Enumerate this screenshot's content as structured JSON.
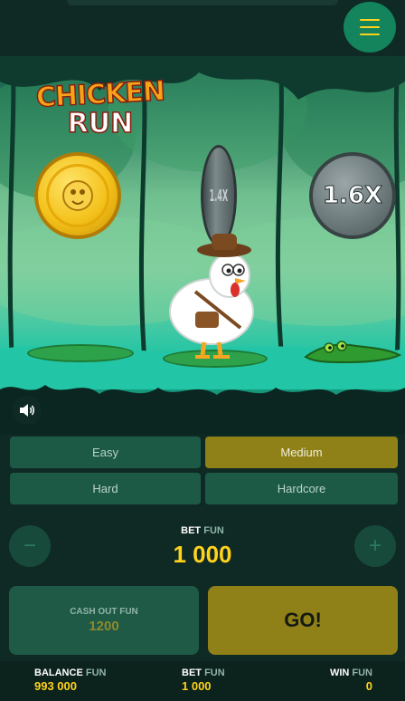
{
  "game": {
    "logo_line1": "CHICKEN",
    "logo_line2": "RUN",
    "lane_multiplier_side": "1.4X",
    "lane_multiplier": "1.6X"
  },
  "difficulty": {
    "options": [
      "Easy",
      "Medium",
      "Hard",
      "Hardcore"
    ],
    "selected": "Medium"
  },
  "bet": {
    "label": "BET",
    "currency": "FUN",
    "value": "1 000",
    "decrease_icon": "minus-icon",
    "increase_icon": "plus-icon"
  },
  "cashout": {
    "label": "CASH OUT",
    "currency": "FUN",
    "value": "1200"
  },
  "go_label": "GO!",
  "footer": {
    "balance_label": "BALANCE",
    "balance_currency": "FUN",
    "balance_value": "993 000",
    "bet_label": "BET",
    "bet_currency": "FUN",
    "bet_value": "1 000",
    "win_label": "WIN",
    "win_currency": "FUN",
    "win_value": "0"
  },
  "colors": {
    "accent": "#ffd21c",
    "panel": "#1d5a45",
    "selected": "#8f8017",
    "menu_button": "#13845c"
  },
  "icons": {
    "menu": "hamburger-menu-icon",
    "sound": "speaker-icon"
  }
}
